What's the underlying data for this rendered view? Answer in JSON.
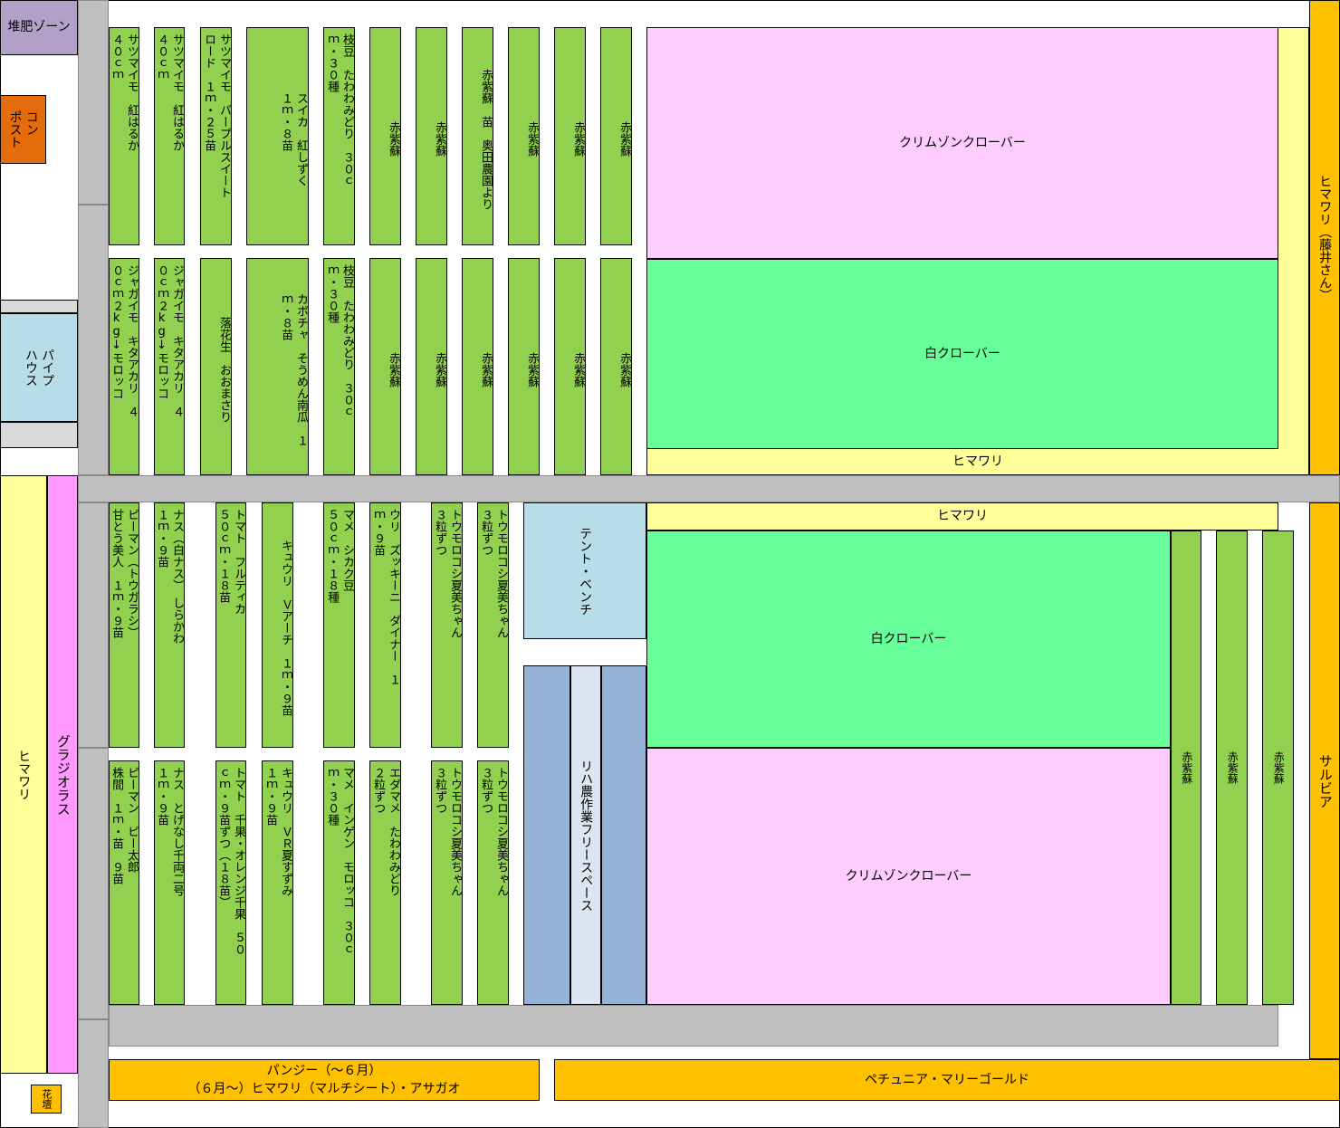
{
  "left": {
    "compost_zone": "堆肥ゾーン",
    "compost": "コン\nポスト",
    "pipe_house": "パイプ\nハウス",
    "sunflower": "ヒマワリ",
    "gladiolus": "グラジオラス",
    "flower_bed": "花壇"
  },
  "top_beds": {
    "upper": [
      "サツマイモ　紅はるか\n４０ｃｍ",
      "サツマイモ　紅はるか\n４０ｃｍ",
      "サツマイモ　パープルスイート\nロード　１ｍ・２５苗",
      "スイカ　紅しずく\n１ｍ・８苗",
      "枝豆　たわわみどり　３０ｃ\nｍ・３０種",
      "赤紫蘇",
      "赤紫蘇",
      "赤紫蘇　苗　奥田農園より",
      "赤紫蘇",
      "赤紫蘇",
      "赤紫蘇"
    ],
    "lower": [
      "ジャガイモ　キタアカリ　４\n０ｃｍ２kg↓モロッコ",
      "ジャガイモ　キタアカリ　４\n０ｃｍ２kg↓モロッコ",
      "落花生　おおまさり",
      "カボチャ　そうめん南瓜　１\nｍ・８苗",
      "枝豆　たわわみどり　３０ｃ\nｍ・３０種",
      "赤紫蘇",
      "赤紫蘇",
      "赤紫蘇",
      "赤紫蘇",
      "赤紫蘇",
      "赤紫蘇"
    ],
    "crimson_clover": "クリムゾンクローバー",
    "white_clover": "白クローバー",
    "sunflower_strip": "ヒマワリ",
    "sunflower_fujii": "ヒマワリ（藤井さん）"
  },
  "bottom_beds": {
    "upper": [
      "ピーマン（トウガラシ）\n甘とう美人　１ｍ・９苗",
      "ナス（白ナス）　しらかわ\n１ｍ・９苗",
      "トマト　フルティカ\n５０ｃｍ・１８苗",
      "キュウリ　Ｖアーチ　１ｍ・９苗",
      "マメ　シカク豆\n５０ｃｍ・１８種",
      "ウリ　ズッキーニ　ダイナー　１\nｍ・９苗",
      "トウモロコシ夏美ちゃん\n３粒ずつ",
      "トウモロコシ夏美ちゃん\n３粒ずつ"
    ],
    "lower": [
      "ピーマン　ピー太郎\n株間　１ｍ・苗　９苗",
      "ナス　とげなし千両二号\n１ｍ・９苗",
      "トマト　千果・オレンジ千果　５０\nｃｍ・９苗ずつ（１８苗）",
      "キュウリ　ＶＲ夏すずみ\n１ｍ・９苗",
      "マメ　インゲン　モロッコ　３０ｃ\nｍ・３０種",
      "エダマメ　たわわみどり\n２粒ずつ",
      "トウモロコシ夏美ちゃん\n３粒ずつ",
      "トウモロコシ夏美ちゃん\n３粒ずつ"
    ],
    "tent_bench": "テント・ベンチ",
    "riha_space": "リハ農作業フリースペース",
    "sunflower_strip": "ヒマワリ",
    "white_clover": "白クローバー",
    "crimson_clover": "クリムゾンクローバー",
    "red_shiso": [
      "赤紫蘇",
      "赤紫蘇",
      "赤紫蘇"
    ],
    "salvia": "サルビア"
  },
  "footer": {
    "pansy": "パンジー（～６月）\n（６月～）ヒマワリ（マルチシート）・アサガオ",
    "petunia": "ペチュニア・マリーゴールド"
  },
  "colors": {
    "vegetable_bed": "#92d050",
    "white_clover": "#66ff99",
    "crimson_clover": "#ffccff",
    "gladiolus": "#ff99ff",
    "sunflower": "#ffff99",
    "salvia_orange": "#ffc000",
    "compost": "#e46c0a",
    "compost_zone": "#b1a0c7",
    "pipe_house": "#b7dee8",
    "path_gray": "#c0c0c0"
  }
}
